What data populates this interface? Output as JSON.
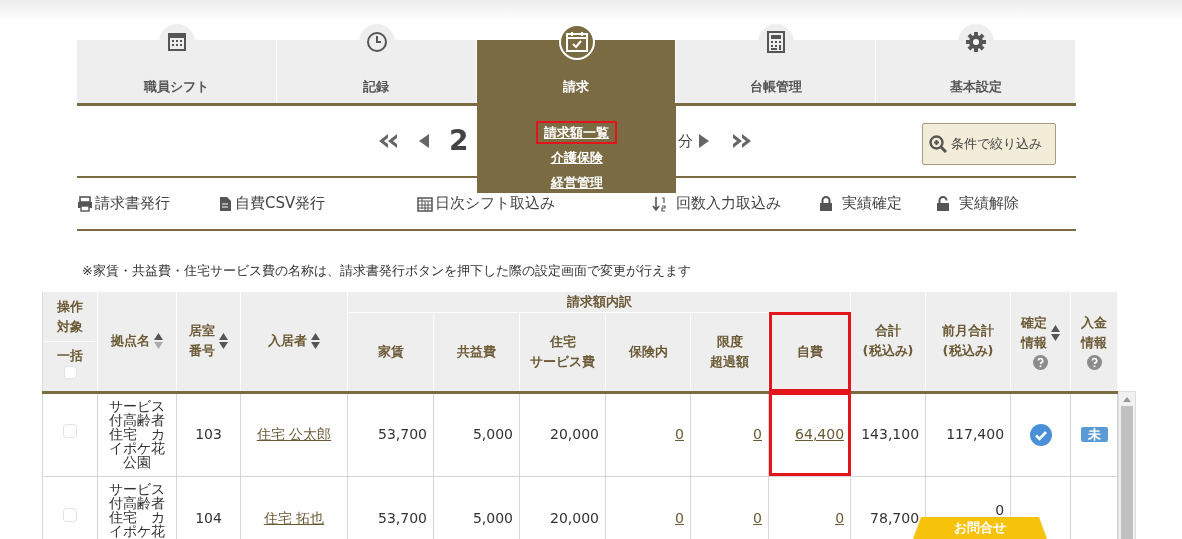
{
  "nav": {
    "tabs": [
      {
        "label": "職員シフト",
        "selected": false
      },
      {
        "label": "記録",
        "selected": false
      },
      {
        "label": "請求",
        "selected": true
      },
      {
        "label": "台帳管理",
        "selected": false
      },
      {
        "label": "基本設定",
        "selected": false
      }
    ],
    "submenu": [
      {
        "label": "請求額一覧",
        "highlighted": true
      },
      {
        "label": "介護保険",
        "highlighted": false
      },
      {
        "label": "経営管理",
        "highlighted": false
      }
    ]
  },
  "pager": {
    "month_fragment": "2",
    "suffix": "分"
  },
  "filter_button": {
    "label": "条件で絞り込み"
  },
  "toolbar": [
    {
      "label": "請求書発行"
    },
    {
      "label": "自費CSV発行"
    },
    {
      "label": "日次シフト取込み"
    },
    {
      "label": "回数入力取込み"
    },
    {
      "label": "実績確定"
    },
    {
      "label": "実績解除"
    }
  ],
  "note": "※家賃・共益費・住宅サービス費の名称は、請求書発行ボタンを押下した際の設定画面で変更が行えます",
  "table": {
    "select_header": {
      "lines": [
        "操作",
        "対象"
      ],
      "bulk_label": "一括",
      "bulk_checked": false
    },
    "group_header": "請求額内訳",
    "columns": [
      {
        "lines": [
          "拠点名"
        ],
        "sortable": true,
        "sorted_ascending": true,
        "highlighted": false
      },
      {
        "lines": [
          "居室",
          "番号"
        ],
        "sortable": true,
        "sorted_ascending": false,
        "highlighted": false
      },
      {
        "lines": [
          "入居者"
        ],
        "sortable": true,
        "sorted_ascending": false,
        "highlighted": false
      },
      {
        "lines": [
          "家賃"
        ],
        "sortable": false,
        "highlighted": false
      },
      {
        "lines": [
          "共益費"
        ],
        "sortable": false,
        "highlighted": false
      },
      {
        "lines": [
          "住宅",
          "サービス費"
        ],
        "sortable": false,
        "highlighted": false
      },
      {
        "lines": [
          "保険内"
        ],
        "sortable": false,
        "highlighted": false
      },
      {
        "lines": [
          "限度",
          "超過額"
        ],
        "sortable": false,
        "highlighted": false
      },
      {
        "lines": [
          "自費"
        ],
        "sortable": false,
        "highlighted": true
      },
      {
        "lines": [
          "合計",
          "(税込み)"
        ],
        "sortable": false,
        "highlighted": false
      },
      {
        "lines": [
          "前月合計",
          "(税込み)"
        ],
        "sortable": false,
        "highlighted": false
      },
      {
        "lines": [
          "確定",
          "情報"
        ],
        "sortable": true,
        "sorted_ascending": false,
        "help": true,
        "highlighted": false
      },
      {
        "lines": [
          "入金",
          "情報"
        ],
        "sortable": false,
        "help": true,
        "highlighted": false
      }
    ],
    "rows": [
      {
        "checked": false,
        "site": "サービス付高齢者住宅　カイポケ花公園",
        "room": "103",
        "resident": "住宅 公太郎",
        "rent": "53,700",
        "common_fee": "5,000",
        "housing_service": "20,000",
        "insured": "0",
        "over_limit": "0",
        "self_pay": "64,400",
        "self_pay_highlighted": true,
        "total": "143,100",
        "prev_total": "117,400",
        "confirmed": true,
        "payment": "未"
      },
      {
        "checked": false,
        "site": "サービス付高齢者住宅　カイポケ花",
        "room": "104",
        "resident": "住宅 拓也",
        "rent": "53,700",
        "common_fee": "5,000",
        "housing_service": "20,000",
        "insured": "0",
        "over_limit": "0",
        "self_pay": "0",
        "self_pay_highlighted": false,
        "total": "78,700",
        "prev_total": "0",
        "confirmed": false
      }
    ]
  },
  "contact_tab": {
    "label": "お問合せ"
  }
}
